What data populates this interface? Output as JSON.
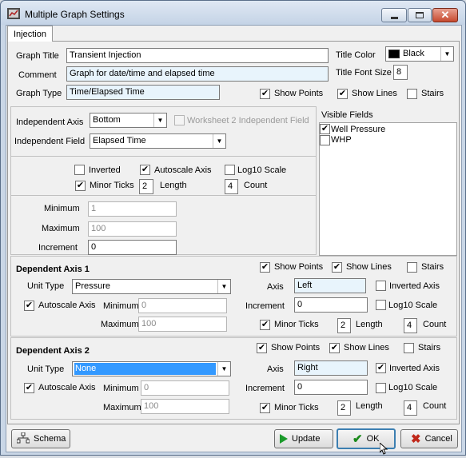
{
  "window": {
    "title": "Multiple Graph Settings"
  },
  "tabs": [
    {
      "label": "Injection"
    }
  ],
  "top": {
    "graph_title_label": "Graph Title",
    "graph_title_value": "Transient Injection",
    "comment_label": "Comment",
    "comment_value": "Graph for date/time and elapsed time",
    "graph_type_label": "Graph Type",
    "graph_type_value": "Time/Elapsed Time",
    "title_color_label": "Title Color",
    "title_color_value": "Black",
    "title_color_swatch": "#000000",
    "title_font_size_label": "Title Font Size",
    "title_font_size_value": "8",
    "show_points_label": "Show Points",
    "show_lines_label": "Show Lines",
    "stairs_label": "Stairs"
  },
  "independent": {
    "axis_label": "Independent Axis",
    "axis_value": "Bottom",
    "worksheet2_label": "Worksheet 2 Independent Field",
    "field_label": "Independent Field",
    "field_value": "Elapsed Time",
    "inverted_label": "Inverted",
    "autoscale_label": "Autoscale Axis",
    "log10_label": "Log10 Scale",
    "minor_ticks_label": "Minor Ticks",
    "length_label": "Length",
    "length_value": "2",
    "count_label": "Count",
    "count_value": "4",
    "minimum_label": "Minimum",
    "minimum_value": "1",
    "maximum_label": "Maximum",
    "maximum_value": "100",
    "increment_label": "Increment",
    "increment_value": "0"
  },
  "visible_fields": {
    "label": "Visible Fields",
    "items": [
      {
        "label": "Well Pressure",
        "checked": true
      },
      {
        "label": "WHP",
        "checked": false
      }
    ]
  },
  "dep1": {
    "heading": "Dependent Axis 1",
    "show_points_label": "Show Points",
    "show_lines_label": "Show Lines",
    "stairs_label": "Stairs",
    "unit_type_label": "Unit Type",
    "unit_type_value": "Pressure",
    "axis_label": "Axis",
    "axis_value": "Left",
    "inverted_label": "Inverted Axis",
    "autoscale_label": "Autoscale Axis",
    "minimum_label": "Minimum",
    "minimum_value": "0",
    "increment_label": "Increment",
    "increment_value": "0",
    "log10_label": "Log10 Scale",
    "maximum_label": "Maximum",
    "maximum_value": "100",
    "minor_ticks_label": "Minor Ticks",
    "length_label": "Length",
    "length_value": "2",
    "count_label": "Count",
    "count_value": "4"
  },
  "dep2": {
    "heading": "Dependent Axis 2",
    "show_points_label": "Show Points",
    "show_lines_label": "Show Lines",
    "stairs_label": "Stairs",
    "unit_type_label": "Unit Type",
    "unit_type_value": "None",
    "axis_label": "Axis",
    "axis_value": "Right",
    "inverted_label": "Inverted Axis",
    "autoscale_label": "Autoscale Axis",
    "minimum_label": "Minimum",
    "minimum_value": "0",
    "increment_label": "Increment",
    "increment_value": "0",
    "log10_label": "Log10 Scale",
    "maximum_label": "Maximum",
    "maximum_value": "100",
    "minor_ticks_label": "Minor Ticks",
    "length_label": "Length",
    "length_value": "2",
    "count_label": "Count",
    "count_value": "4"
  },
  "footer": {
    "schema_label": "Schema",
    "update_label": "Update",
    "ok_label": "OK",
    "cancel_label": "Cancel"
  },
  "check_mark": "✔",
  "icons": {
    "app": "graph-app-icon",
    "minimize": "minimize-icon",
    "maximize": "maximize-icon",
    "close": "close-icon",
    "schema": "schema-icon",
    "update": "play-icon",
    "ok": "checkmark-icon",
    "cancel": "x-icon"
  },
  "colors": {
    "update_icon": "#1a9a2a",
    "ok_icon": "#1a8a1a",
    "cancel_icon": "#c0281a"
  }
}
